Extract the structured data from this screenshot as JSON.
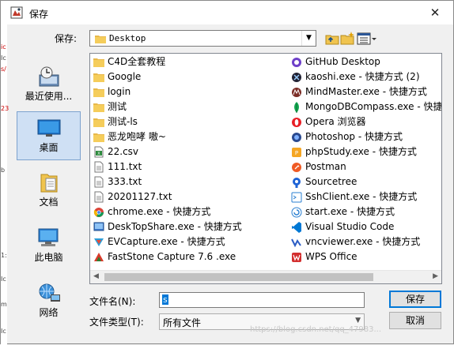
{
  "window": {
    "title": "保存",
    "close_glyph": "✕"
  },
  "edge_text": [
    "ic",
    "Ic",
    "s/",
    "23",
    "b",
    "1:",
    "Ic",
    "m",
    "Ic"
  ],
  "save_in": {
    "label": "保存:",
    "value": "Desktop"
  },
  "places": [
    {
      "label": "最近使用...",
      "icon": "recent-icon"
    },
    {
      "label": "桌面",
      "icon": "desktop-icon",
      "selected": true
    },
    {
      "label": "文档",
      "icon": "documents-icon"
    },
    {
      "label": "此电脑",
      "icon": "computer-icon"
    },
    {
      "label": "网络",
      "icon": "network-icon"
    }
  ],
  "files_col1": [
    {
      "name": "C4D全套教程",
      "icon": "folder-icon"
    },
    {
      "name": "Google",
      "icon": "folder-icon"
    },
    {
      "name": "login",
      "icon": "folder-icon"
    },
    {
      "name": "测试",
      "icon": "folder-icon"
    },
    {
      "name": "测试-ls",
      "icon": "folder-icon"
    },
    {
      "name": "恶龙咆哮 嗷~",
      "icon": "folder-icon"
    },
    {
      "name": "22.csv",
      "icon": "csv-file-icon"
    },
    {
      "name": "111.txt",
      "icon": "text-file-icon"
    },
    {
      "name": "333.txt",
      "icon": "text-file-icon"
    },
    {
      "name": "20201127.txt",
      "icon": "text-file-icon"
    },
    {
      "name": "chrome.exe - 快捷方式",
      "icon": "chrome-icon"
    },
    {
      "name": "DeskTopShare.exe - 快捷方式",
      "icon": "shortcut-icon"
    },
    {
      "name": "EVCapture.exe - 快捷方式",
      "icon": "evcapture-icon"
    },
    {
      "name": "FastStone Capture 7.6 .exe",
      "icon": "faststone-icon"
    }
  ],
  "files_col2": [
    {
      "name": "GitHub Desktop",
      "icon": "github-icon"
    },
    {
      "name": "kaoshi.exe - 快捷方式 (2)",
      "icon": "kaoshi-icon"
    },
    {
      "name": "MindMaster.exe - 快捷方式",
      "icon": "mindmaster-icon"
    },
    {
      "name": "MongoDBCompass.exe - 快捷",
      "icon": "mongodb-icon"
    },
    {
      "name": "Opera 浏览器",
      "icon": "opera-icon"
    },
    {
      "name": "Photoshop - 快捷方式",
      "icon": "photoshop-icon"
    },
    {
      "name": "phpStudy.exe - 快捷方式",
      "icon": "phpstudy-icon"
    },
    {
      "name": "Postman",
      "icon": "postman-icon"
    },
    {
      "name": "Sourcetree",
      "icon": "sourcetree-icon"
    },
    {
      "name": "SshClient.exe - 快捷方式",
      "icon": "sshclient-icon"
    },
    {
      "name": "start.exe - 快捷方式",
      "icon": "start-icon"
    },
    {
      "name": "Visual Studio Code",
      "icon": "vscode-icon"
    },
    {
      "name": "vncviewer.exe - 快捷方式",
      "icon": "vnc-icon"
    },
    {
      "name": "WPS Office",
      "icon": "wps-icon"
    }
  ],
  "filename": {
    "label": "文件名(N):",
    "value": "s"
  },
  "filetype": {
    "label": "文件类型(T):",
    "value": "所有文件"
  },
  "buttons": {
    "save": "保存",
    "cancel": "取消"
  },
  "watermark": "https://blog.csdn.net/qq_47983..."
}
